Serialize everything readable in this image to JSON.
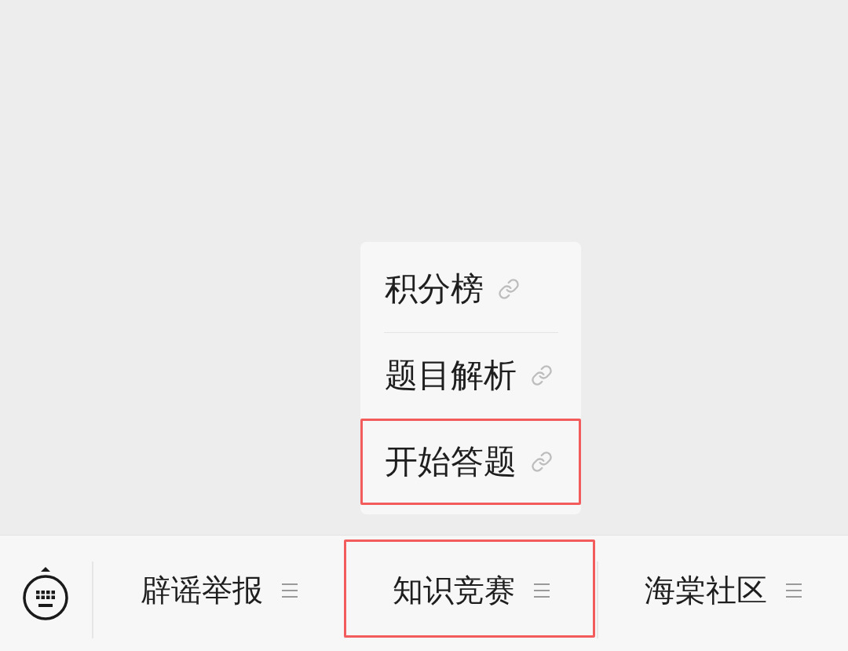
{
  "menu": {
    "items": [
      {
        "label": "积分榜",
        "highlighted": false
      },
      {
        "label": "题目解析",
        "highlighted": false
      },
      {
        "label": "开始答题",
        "highlighted": true
      }
    ]
  },
  "tab_bar": {
    "tabs": [
      {
        "label": "辟谣举报",
        "highlighted": false
      },
      {
        "label": "知识竞赛",
        "highlighted": true
      },
      {
        "label": "海棠社区",
        "highlighted": false
      }
    ]
  }
}
